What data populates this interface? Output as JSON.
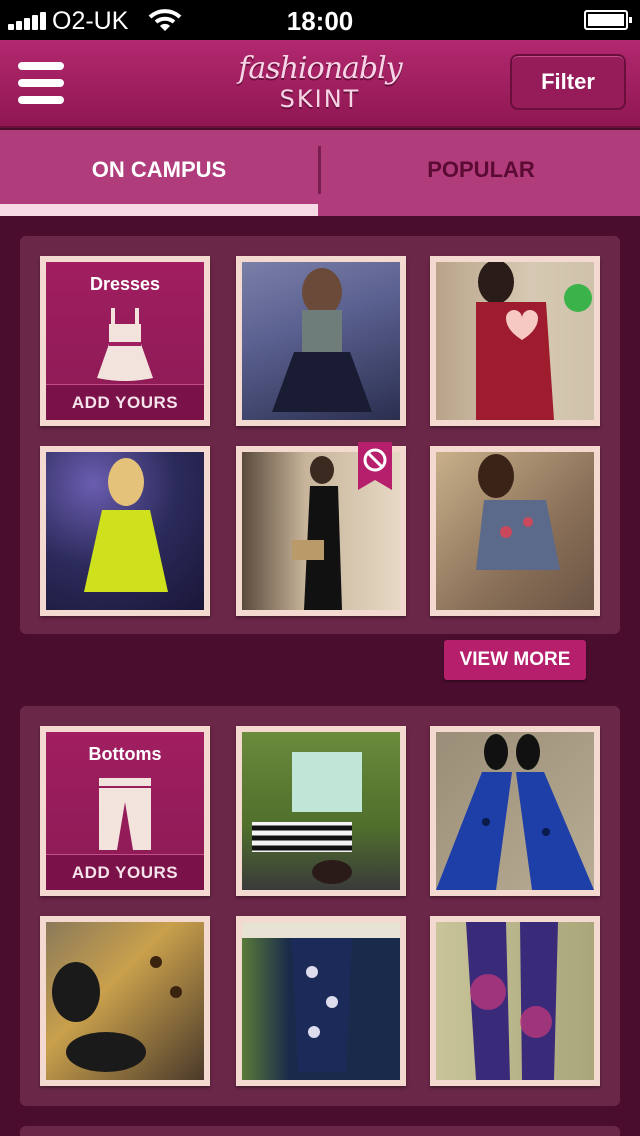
{
  "status_bar": {
    "carrier": "O2-UK",
    "time": "18:00"
  },
  "header": {
    "logo_line1": "fashionably",
    "logo_line2": "SKINT",
    "filter_label": "Filter"
  },
  "tabs": [
    {
      "label": "ON CAMPUS",
      "selected": true
    },
    {
      "label": "POPULAR",
      "selected": false
    }
  ],
  "sections": [
    {
      "category": "Dresses",
      "add_label": "ADD YOURS",
      "icon": "dress-icon"
    },
    {
      "category": "Bottoms",
      "add_label": "ADD YOURS",
      "icon": "trousers-icon"
    }
  ],
  "view_more_label": "VIEW MORE",
  "colors": {
    "brand": "#a11e61",
    "background": "#4a0d2e",
    "panel": "#6b2748",
    "tile_frame": "#f3d9cf"
  }
}
